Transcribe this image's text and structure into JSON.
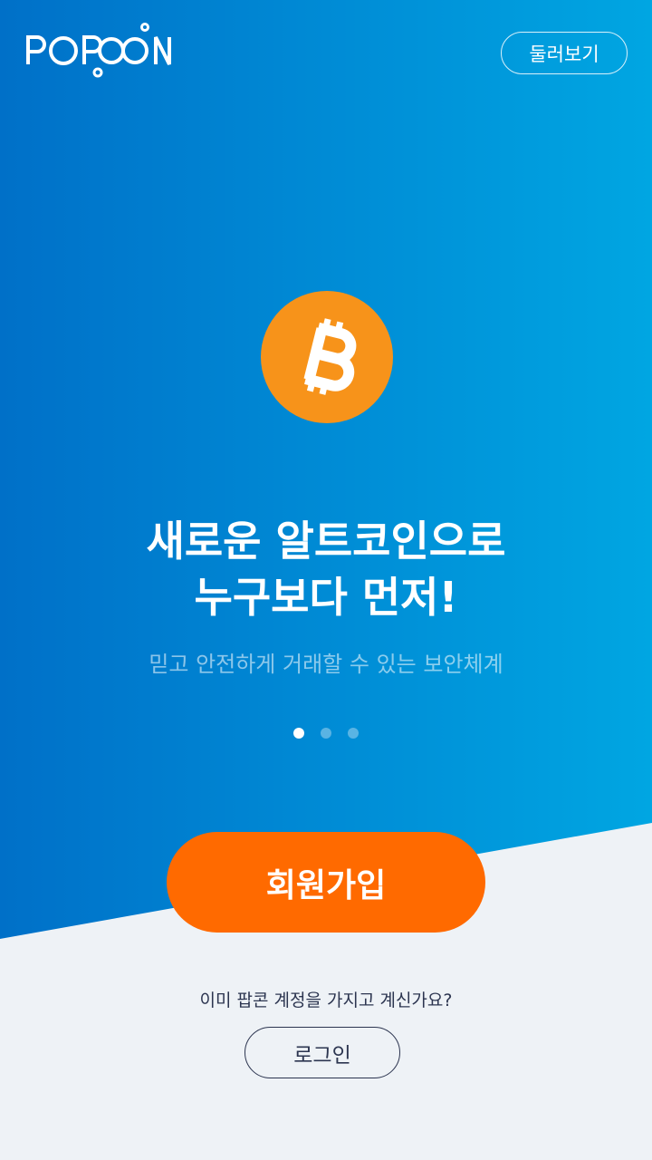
{
  "brand": {
    "logo_text": "POPCON",
    "logo_icon": "infinity-chain-logo"
  },
  "header": {
    "browse_label": "둘러보기"
  },
  "hero": {
    "coin_icon": "bitcoin-icon",
    "headline_line1": "새로운 알트코인으로",
    "headline_line2": "누구보다 먼저!",
    "subtext": "믿고 안전하게 거래할 수 있는 보안체계"
  },
  "carousel": {
    "total": 3,
    "active_index": 0
  },
  "actions": {
    "signup_label": "회원가입",
    "question": "이미 팝콘 계정을 가지고 계신가요?",
    "login_label": "로그인"
  },
  "colors": {
    "gradient_start": "#0070c8",
    "gradient_end": "#00a6e2",
    "bottom_bg": "#eef2f6",
    "accent_orange": "#ff6a00",
    "bitcoin_orange": "#f7931a",
    "dark_text": "#2c3550"
  }
}
